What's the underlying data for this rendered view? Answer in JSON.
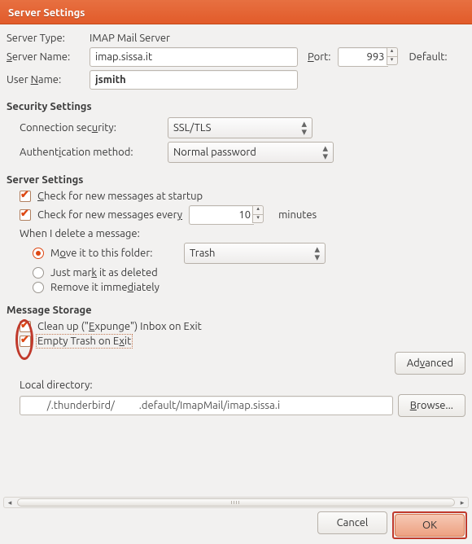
{
  "title": "Server Settings",
  "server_type": {
    "label": "Server Type:",
    "value": "IMAP Mail Server"
  },
  "server_name": {
    "label": "Server Name:",
    "value": "imap.sissa.it"
  },
  "port": {
    "label": "Port:",
    "value": "993"
  },
  "default_label": "Default:",
  "user_name": {
    "label": "User Name:",
    "value": "jsmith"
  },
  "security": {
    "title": "Security Settings",
    "conn_sec_label": "Connection security:",
    "conn_sec_value": "SSL/TLS",
    "auth_label": "Authentication method:",
    "auth_value": "Normal password"
  },
  "server_settings": {
    "title": "Server Settings",
    "check_startup": "Check for new messages at startup",
    "check_every_pre": "Check for new messages every",
    "check_every_value": "10",
    "check_every_unit": "minutes",
    "delete_label": "When I delete a message:",
    "move_label": "Move it to this folder:",
    "trash_value": "Trash",
    "mark_label": "Just mark it as deleted",
    "remove_label": "Remove it immediately"
  },
  "storage": {
    "title": "Message Storage",
    "cleanup": "Clean up (\"Expunge\") Inbox on Exit",
    "empty_trash": "Empty Trash on Exit",
    "advanced": "Advanced",
    "local_dir_label": "Local directory:",
    "local_dir_value": "         /.thunderbird/          .default/ImapMail/imap.sissa.i",
    "browse": "Browse..."
  },
  "footer": {
    "cancel": "Cancel",
    "ok": "OK"
  }
}
